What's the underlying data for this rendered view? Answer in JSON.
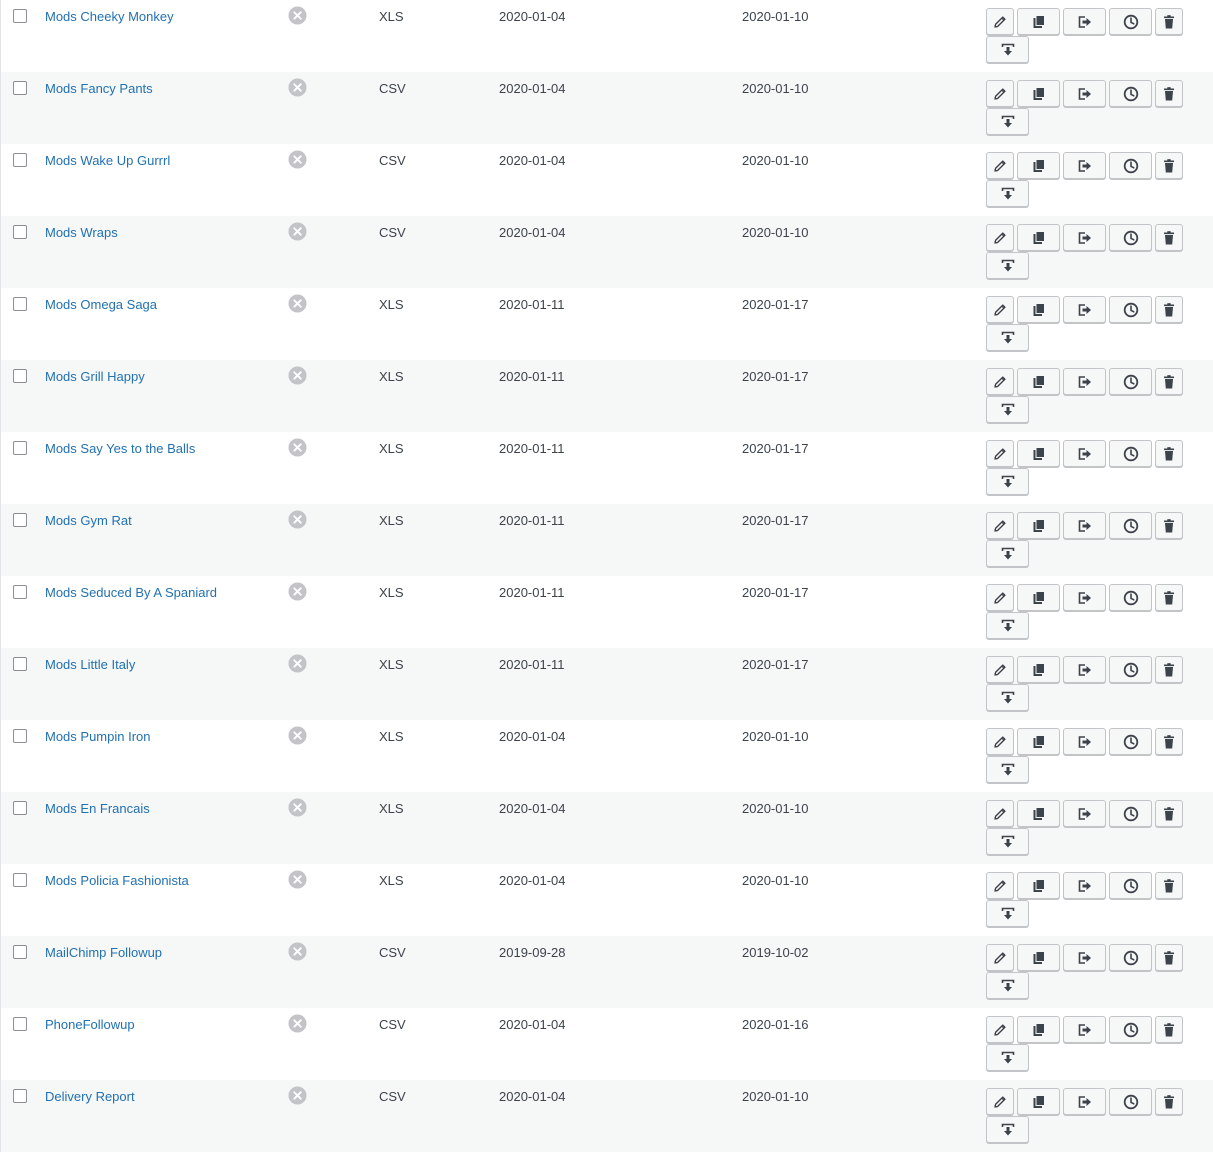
{
  "rows": [
    {
      "name": "Mods Cheeky Monkey",
      "format": "XLS",
      "start": "2020-01-04",
      "end": "2020-01-10"
    },
    {
      "name": "Mods Fancy Pants",
      "format": "CSV",
      "start": "2020-01-04",
      "end": "2020-01-10"
    },
    {
      "name": "Mods Wake Up Gurrrl",
      "format": "CSV",
      "start": "2020-01-04",
      "end": "2020-01-10"
    },
    {
      "name": "Mods Wraps",
      "format": "CSV",
      "start": "2020-01-04",
      "end": "2020-01-10"
    },
    {
      "name": "Mods Omega Saga",
      "format": "XLS",
      "start": "2020-01-11",
      "end": "2020-01-17"
    },
    {
      "name": "Mods Grill Happy",
      "format": "XLS",
      "start": "2020-01-11",
      "end": "2020-01-17"
    },
    {
      "name": "Mods Say Yes to the Balls",
      "format": "XLS",
      "start": "2020-01-11",
      "end": "2020-01-17"
    },
    {
      "name": "Mods Gym Rat",
      "format": "XLS",
      "start": "2020-01-11",
      "end": "2020-01-17"
    },
    {
      "name": "Mods Seduced By A Spaniard",
      "format": "XLS",
      "start": "2020-01-11",
      "end": "2020-01-17"
    },
    {
      "name": "Mods Little Italy",
      "format": "XLS",
      "start": "2020-01-11",
      "end": "2020-01-17"
    },
    {
      "name": "Mods Pumpin Iron",
      "format": "XLS",
      "start": "2020-01-04",
      "end": "2020-01-10"
    },
    {
      "name": "Mods En Francais",
      "format": "XLS",
      "start": "2020-01-04",
      "end": "2020-01-10"
    },
    {
      "name": "Mods Policia Fashionista",
      "format": "XLS",
      "start": "2020-01-04",
      "end": "2020-01-10"
    },
    {
      "name": "MailChimp Followup",
      "format": "CSV",
      "start": "2019-09-28",
      "end": "2019-10-02"
    },
    {
      "name": "PhoneFollowup",
      "format": "CSV",
      "start": "2020-01-04",
      "end": "2020-01-16"
    },
    {
      "name": "Delivery Report",
      "format": "CSV",
      "start": "2020-01-04",
      "end": "2020-01-10"
    }
  ],
  "status_icon": "disabled-x-circle-icon",
  "action_icons": [
    "pencil-icon",
    "copy-icon",
    "export-icon",
    "clock-icon",
    "trash-icon",
    "download-icon"
  ],
  "colors": {
    "link": "#2271b1",
    "row_alt": "#f6f7f7",
    "icon": "#3c434a",
    "status_icon": "#c3c4c7"
  }
}
